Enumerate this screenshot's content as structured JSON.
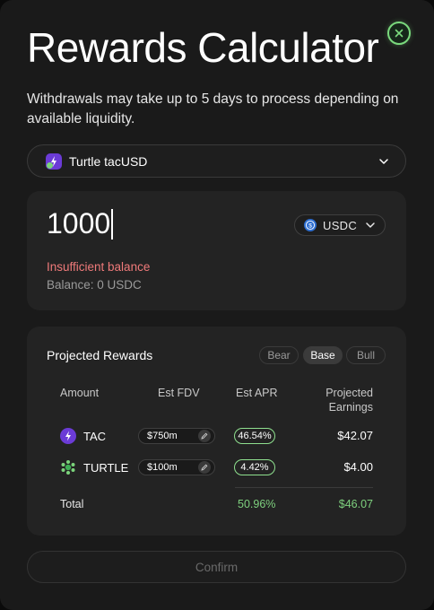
{
  "modal": {
    "title": "Rewards Calculator",
    "notice": "Withdrawals may take up to 5 days to process depending on available liquidity.",
    "close_icon": "close-icon",
    "accent": "#7ad97d"
  },
  "vault_select": {
    "label": "Turtle tacUSD",
    "icon": "turtle-tacusd-icon"
  },
  "amount": {
    "value": "1000",
    "token": "USDC",
    "error": "Insufficient balance",
    "balance": "Balance: 0 USDC"
  },
  "rewards": {
    "title": "Projected Rewards",
    "scenarios": [
      "Bear",
      "Base",
      "Bull"
    ],
    "selected_scenario": "Base",
    "columns": {
      "amount": "Amount",
      "fdv": "Est FDV",
      "apr": "Est APR",
      "earnings": "Projected Earnings"
    },
    "rows": [
      {
        "token": "TAC",
        "fdv": "$750m",
        "apr": "46.54%",
        "earnings": "$42.07",
        "icon": "tac-icon"
      },
      {
        "token": "TURTLE",
        "fdv": "$100m",
        "apr": "4.42%",
        "earnings": "$4.00",
        "icon": "turtle-icon"
      }
    ],
    "total": {
      "label": "Total",
      "apr": "50.96%",
      "earnings": "$46.07"
    }
  },
  "confirm_label": "Confirm"
}
